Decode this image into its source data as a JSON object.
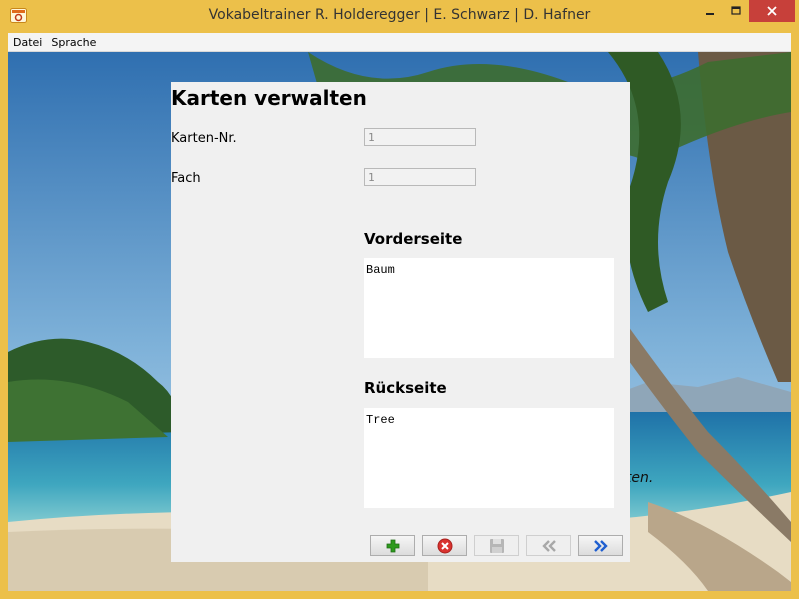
{
  "window": {
    "title": "Vokabeltrainer R. Holderegger | E. Schwarz | D. Hafner"
  },
  "menu": {
    "items": [
      "Datei",
      "Sprache"
    ]
  },
  "background": {
    "partial_text": "lten."
  },
  "panel": {
    "heading": "Karten verwalten",
    "card_number": {
      "label": "Karten-Nr.",
      "value": "1"
    },
    "box": {
      "label": "Fach",
      "value": "1"
    },
    "front": {
      "title": "Vorderseite",
      "text": "Baum"
    },
    "back": {
      "title": "Rückseite",
      "text": "Tree"
    }
  },
  "toolbar": {
    "buttons": [
      {
        "icon": "plus-icon",
        "enabled": true
      },
      {
        "icon": "delete-icon",
        "enabled": true
      },
      {
        "icon": "save-icon",
        "enabled": false
      },
      {
        "icon": "previous-icon",
        "enabled": false
      },
      {
        "icon": "next-icon",
        "enabled": true
      }
    ]
  },
  "colors": {
    "titlebar": "#ecc04a",
    "close": "#c7403a",
    "panel": "#f0f0f0",
    "add": "#2e9a1e",
    "delete": "#d9322e",
    "next": "#1f5fd0"
  }
}
